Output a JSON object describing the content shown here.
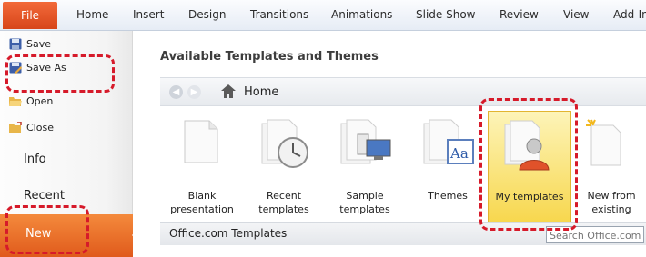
{
  "ribbon": {
    "tabs": [
      "File",
      "Home",
      "Insert",
      "Design",
      "Transitions",
      "Animations",
      "Slide Show",
      "Review",
      "View",
      "Add-In"
    ]
  },
  "backstage": {
    "save": "Save",
    "save_as": "Save As",
    "open": "Open",
    "close": "Close",
    "info": "Info",
    "recent": "Recent",
    "new": "New"
  },
  "main": {
    "title": "Available Templates and Themes",
    "nav": {
      "home": "Home"
    },
    "templates": [
      {
        "line1": "Blank",
        "line2": "presentation",
        "icon": "blank-document-icon"
      },
      {
        "line1": "Recent",
        "line2": "templates",
        "icon": "recent-templates-icon"
      },
      {
        "line1": "Sample",
        "line2": "templates",
        "icon": "sample-templates-icon"
      },
      {
        "line1": "Themes",
        "line2": "",
        "icon": "themes-icon"
      },
      {
        "line1": "My templates",
        "line2": "",
        "icon": "my-templates-icon",
        "selected": true
      },
      {
        "line1": "New from",
        "line2": "existing",
        "icon": "new-from-existing-icon"
      }
    ],
    "office_com": "Office.com Templates",
    "search_placeholder": "Search Office.com"
  },
  "colors": {
    "file_tab": "#e05a1c",
    "highlight": "#d61a2a",
    "selected_tile": "#f7d64a"
  }
}
